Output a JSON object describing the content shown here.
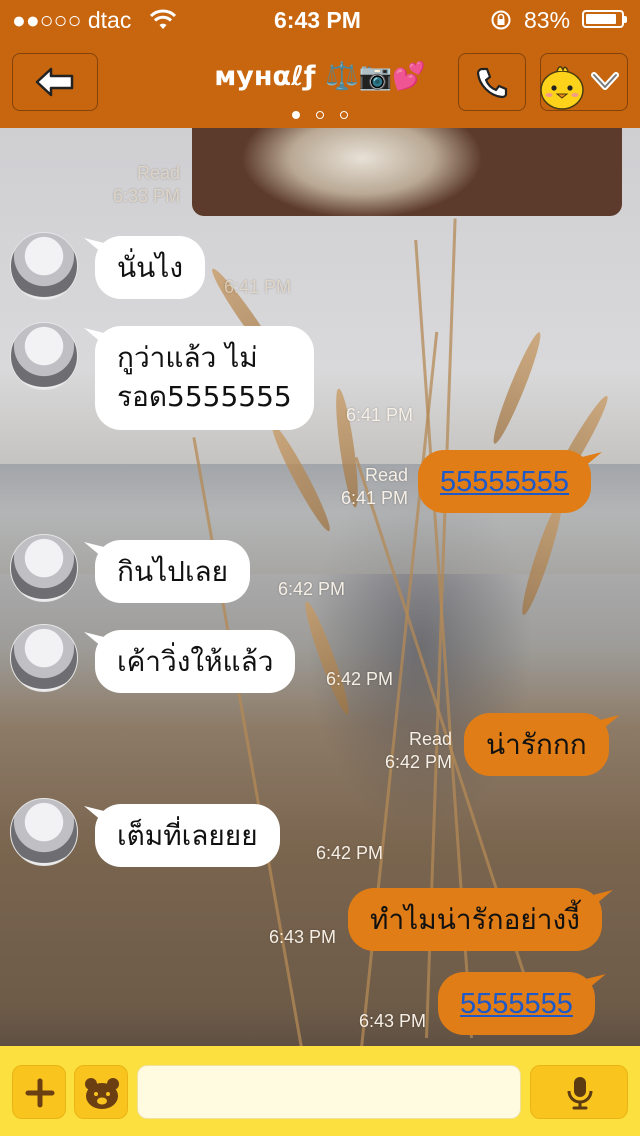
{
  "status_bar": {
    "carrier": "●●○○○ dtac",
    "time": "6:43 PM",
    "battery": "83%"
  },
  "header": {
    "title": "мyнαℓƒ ⚖️📷💕",
    "page_indicator": {
      "pages": 3,
      "current": 1
    },
    "icons": [
      "back-arrow-icon",
      "phone-icon",
      "sticker-chick-icon",
      "chevron-down-icon"
    ]
  },
  "messages": [
    {
      "side": "out",
      "type": "image",
      "meta_status": "Read",
      "meta_time": "6:33 PM"
    },
    {
      "side": "in",
      "text": "นั่นไง",
      "time": "6:41 PM"
    },
    {
      "side": "in",
      "line1": "กูว่าแล้ว ไม่",
      "line2": "รอด5555555",
      "time": "6:41 PM"
    },
    {
      "side": "out",
      "text": "55555555",
      "is_link": true,
      "status": "Read",
      "time": "6:41 PM"
    },
    {
      "side": "in",
      "text": "กินไปเลย",
      "time": "6:42 PM"
    },
    {
      "side": "in",
      "text": "เค้าวิ่งให้แล้ว",
      "time": "6:42 PM"
    },
    {
      "side": "out",
      "text": "น่ารักกก",
      "status": "Read",
      "time": "6:42 PM"
    },
    {
      "side": "in",
      "text": "เต็มที่เลยยย",
      "time": "6:42 PM"
    },
    {
      "side": "out",
      "text": "ทำไมน่ารักอย่างงี้",
      "time": "6:43 PM"
    },
    {
      "side": "out",
      "text": "5555555",
      "is_link": true,
      "time": "6:43 PM"
    }
  ],
  "composer": {
    "plus_label": "+",
    "icons": [
      "plus-icon",
      "bear-sticker-icon",
      "microphone-icon"
    ],
    "input_value": ""
  },
  "colors": {
    "header": "#c8660f",
    "outgoing_bubble": "#e07d17",
    "incoming_bubble": "#ffffff",
    "composer_bar": "#fce03f",
    "composer_button": "#f9c41e",
    "link": "#1d59c9"
  }
}
